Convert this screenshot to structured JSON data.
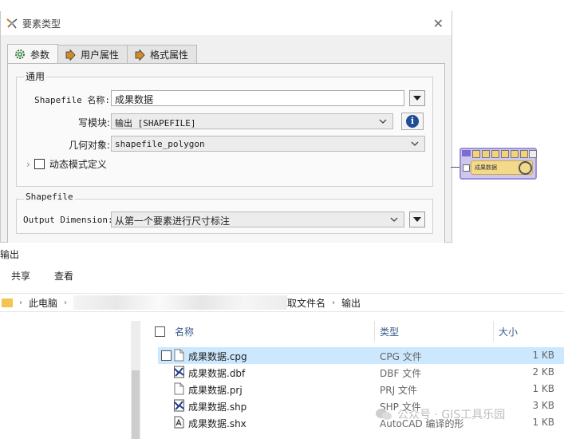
{
  "dialog": {
    "title": "要素类型",
    "close_glyph": "✕",
    "tabs": [
      {
        "label": "参数",
        "icon": "gear-icon",
        "active": true
      },
      {
        "label": "用户属性",
        "icon": "arrow-right-icon",
        "active": false
      },
      {
        "label": "格式属性",
        "icon": "arrow-right-icon",
        "active": false
      }
    ],
    "general": {
      "title": "通用",
      "shapefile_name_label": "Shapefile 名称:",
      "shapefile_name_value": "成果数据",
      "writer_label": "写模块:",
      "writer_value": "输出 [SHAPEFILE]",
      "geometry_label": "几何对象:",
      "geometry_value": "shapefile_polygon",
      "dynamic_schema_label": "动态模式定义"
    },
    "shapefile_group": {
      "title": "Shapefile",
      "output_dimension_label": "Output Dimension:",
      "output_dimension_value": "从第一个要素进行尺寸标注"
    }
  },
  "workspace_node": {
    "label": "成果数据",
    "brand_color": "#9b8fd9"
  },
  "explorer": {
    "window_title": "输出",
    "ribbon": [
      "共享",
      "查看"
    ],
    "address": {
      "root": "此电脑",
      "partial_folder": "取文件名",
      "current": "输出"
    },
    "columns": {
      "name": "名称",
      "type": "类型",
      "size": "大小"
    },
    "files": [
      {
        "name": "成果数据.cpg",
        "type": "CPG 文件",
        "size": "1 KB",
        "icon": "file-icon",
        "selected": true
      },
      {
        "name": "成果数据.dbf",
        "type": "DBF 文件",
        "size": "2 KB",
        "icon": "gis-data-icon",
        "selected": false
      },
      {
        "name": "成果数据.prj",
        "type": "PRJ 文件",
        "size": "1 KB",
        "icon": "file-icon",
        "selected": false
      },
      {
        "name": "成果数据.shp",
        "type": "SHP 文件",
        "size": "3 KB",
        "icon": "gis-data-icon",
        "selected": false
      },
      {
        "name": "成果数据.shx",
        "type": "AutoCAD 编译的形",
        "size": "1 KB",
        "icon": "autocad-file-icon",
        "selected": false
      }
    ],
    "selection_color": "#cce8ff"
  },
  "watermark": "公众号 · GIS工具乐园"
}
